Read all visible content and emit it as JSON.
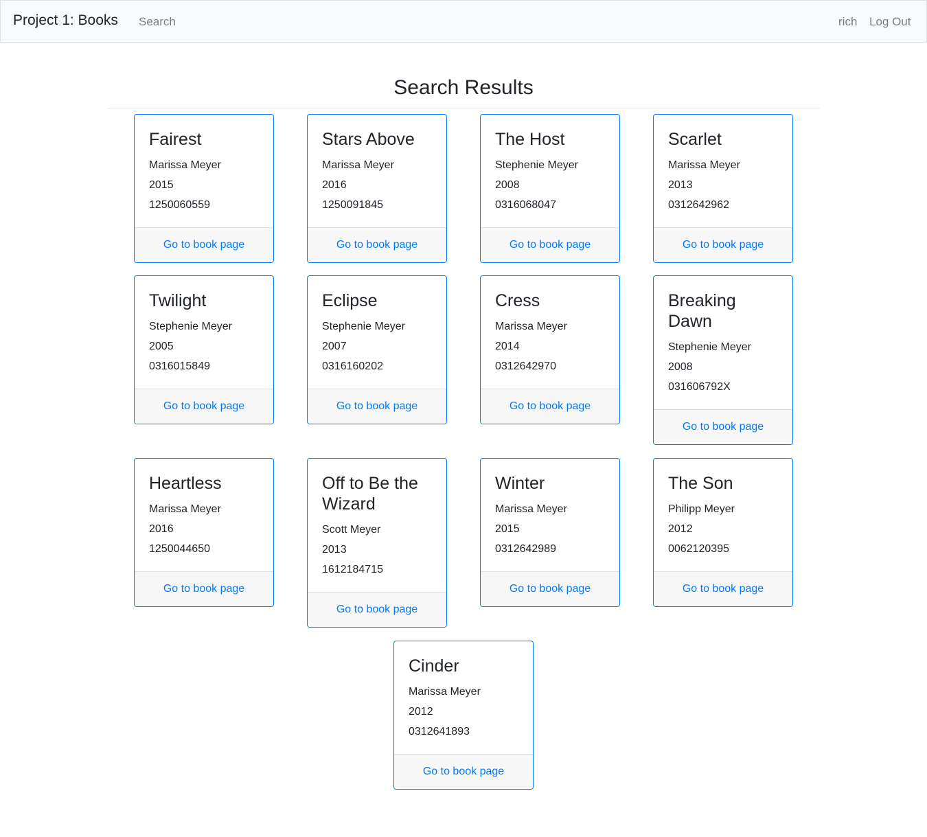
{
  "navbar": {
    "brand": "Project 1: Books",
    "search_link": "Search",
    "username": "rich",
    "logout": "Log Out"
  },
  "main": {
    "title": "Search Results"
  },
  "card_link_label": "Go to book page",
  "books": [
    {
      "title": "Fairest",
      "author": "Marissa Meyer",
      "year": "2015",
      "isbn": "1250060559"
    },
    {
      "title": "Stars Above",
      "author": "Marissa Meyer",
      "year": "2016",
      "isbn": "1250091845"
    },
    {
      "title": "The Host",
      "author": "Stephenie Meyer",
      "year": "2008",
      "isbn": "0316068047"
    },
    {
      "title": "Scarlet",
      "author": "Marissa Meyer",
      "year": "2013",
      "isbn": "0312642962"
    },
    {
      "title": "Twilight",
      "author": "Stephenie Meyer",
      "year": "2005",
      "isbn": "0316015849"
    },
    {
      "title": "Eclipse",
      "author": "Stephenie Meyer",
      "year": "2007",
      "isbn": "0316160202"
    },
    {
      "title": "Cress",
      "author": "Marissa Meyer",
      "year": "2014",
      "isbn": "0312642970"
    },
    {
      "title": "Breaking Dawn",
      "author": "Stephenie Meyer",
      "year": "2008",
      "isbn": "031606792X"
    },
    {
      "title": "Heartless",
      "author": "Marissa Meyer",
      "year": "2016",
      "isbn": "1250044650"
    },
    {
      "title": "Off to Be the Wizard",
      "author": "Scott Meyer",
      "year": "2013",
      "isbn": "1612184715"
    },
    {
      "title": "Winter",
      "author": "Marissa Meyer",
      "year": "2015",
      "isbn": "0312642989"
    },
    {
      "title": "The Son",
      "author": "Philipp Meyer",
      "year": "2012",
      "isbn": "0062120395"
    },
    {
      "title": "Cinder",
      "author": "Marissa Meyer",
      "year": "2012",
      "isbn": "0312641893"
    }
  ]
}
